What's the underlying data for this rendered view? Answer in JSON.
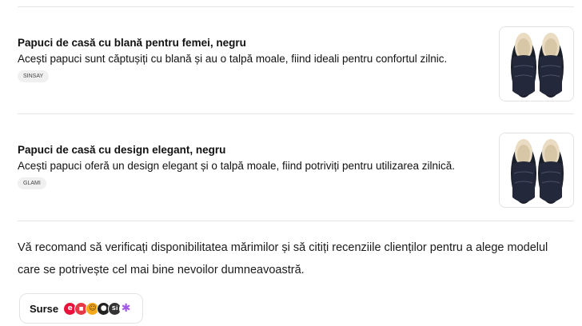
{
  "products": [
    {
      "title": "Papuci de casă cu blană pentru femei, negru",
      "description": "Acești papuci sunt căptușiți cu blană și au o talpă moale, fiind ideali pentru confortul zilnic.",
      "badge": "SINSAY",
      "image_icon": "slippers-image"
    },
    {
      "title": "Papuci de casă cu design elegant, negru",
      "description": "Acești papuci oferă un design elegant și o talpă moale, fiind potriviți pentru utilizarea zilnică.",
      "badge": "GLAMI",
      "image_icon": "slippers-image"
    }
  ],
  "summary": "Vă recomand să verificați disponibilitatea mărimilor și să citiți recenziile clienților pentru a alege modelul care se potrivește cel mai bine nevoilor dumneavoastră.",
  "sources": {
    "label": "Surse",
    "icons": [
      {
        "name": "source-e-icon",
        "color": "#e8133a",
        "glyph": "e"
      },
      {
        "name": "source-store-icon",
        "color": "#e63946",
        "glyph": "▪"
      },
      {
        "name": "source-smiley-icon",
        "color": "#f4a91c",
        "glyph": "☺"
      },
      {
        "name": "source-dark-icon",
        "color": "#222222",
        "glyph": "●"
      },
      {
        "name": "source-si-icon",
        "color": "#333333",
        "glyph": "Si"
      },
      {
        "name": "source-asterisk-icon",
        "color": "#a259e6",
        "glyph": "✱"
      }
    ]
  }
}
